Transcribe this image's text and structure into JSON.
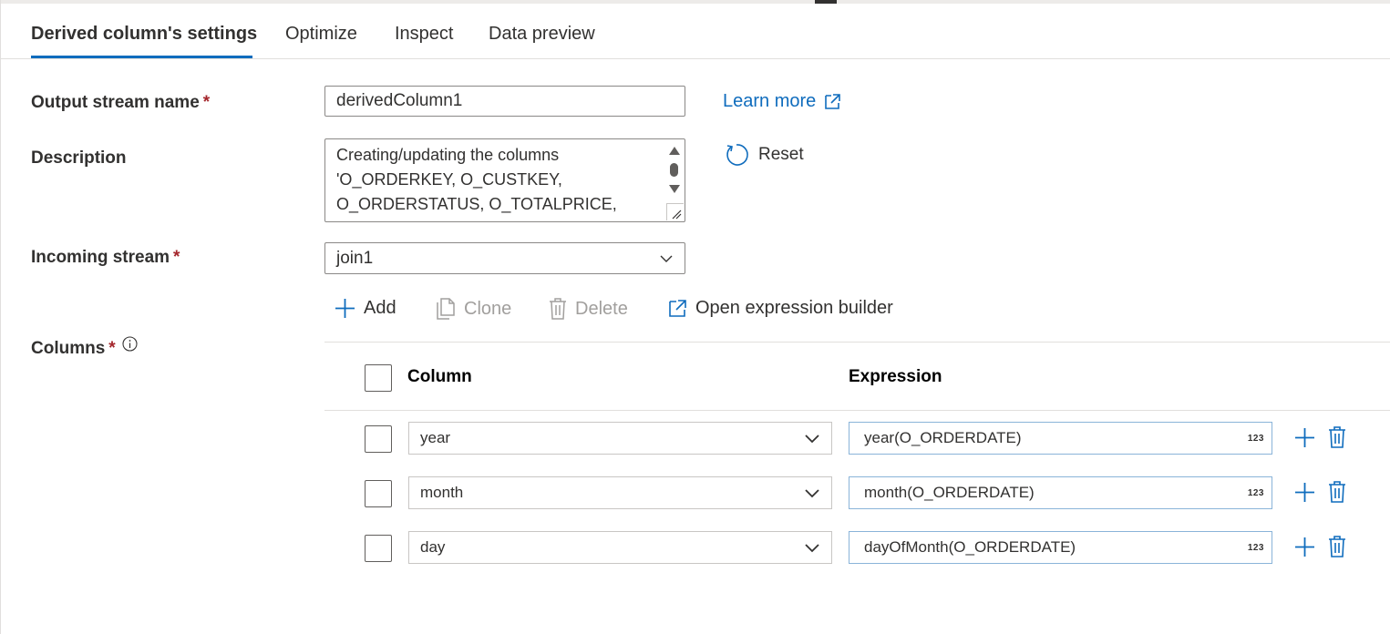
{
  "tabs": [
    {
      "label": "Derived column's settings"
    },
    {
      "label": "Optimize"
    },
    {
      "label": "Inspect"
    },
    {
      "label": "Data preview"
    }
  ],
  "form": {
    "output_stream": {
      "label": "Output stream name",
      "required": "*",
      "value": "derivedColumn1"
    },
    "description": {
      "label": "Description",
      "value": "Creating/updating the columns 'O_ORDERKEY, O_CUSTKEY, O_ORDERSTATUS, O_TOTALPRICE,"
    },
    "incoming_stream": {
      "label": "Incoming stream",
      "required": "*",
      "value": "join1"
    },
    "columns": {
      "label": "Columns",
      "required": "*"
    }
  },
  "links": {
    "learn_more": "Learn more",
    "reset": "Reset"
  },
  "toolbar": {
    "add": "Add",
    "clone": "Clone",
    "delete": "Delete",
    "open_expression_builder": "Open expression builder"
  },
  "grid": {
    "headers": {
      "column": "Column",
      "expression": "Expression"
    },
    "type_badge": "123",
    "rows": [
      {
        "column": "year",
        "expression": "year(O_ORDERDATE)"
      },
      {
        "column": "month",
        "expression": "month(O_ORDERDATE)"
      },
      {
        "column": "day",
        "expression": "dayOfMonth(O_ORDERDATE)"
      }
    ]
  },
  "colors": {
    "accent": "#0f6cbd",
    "required": "#a4262c",
    "text": "#323130",
    "disabled": "#a19f9d",
    "border": "#8a8886"
  }
}
